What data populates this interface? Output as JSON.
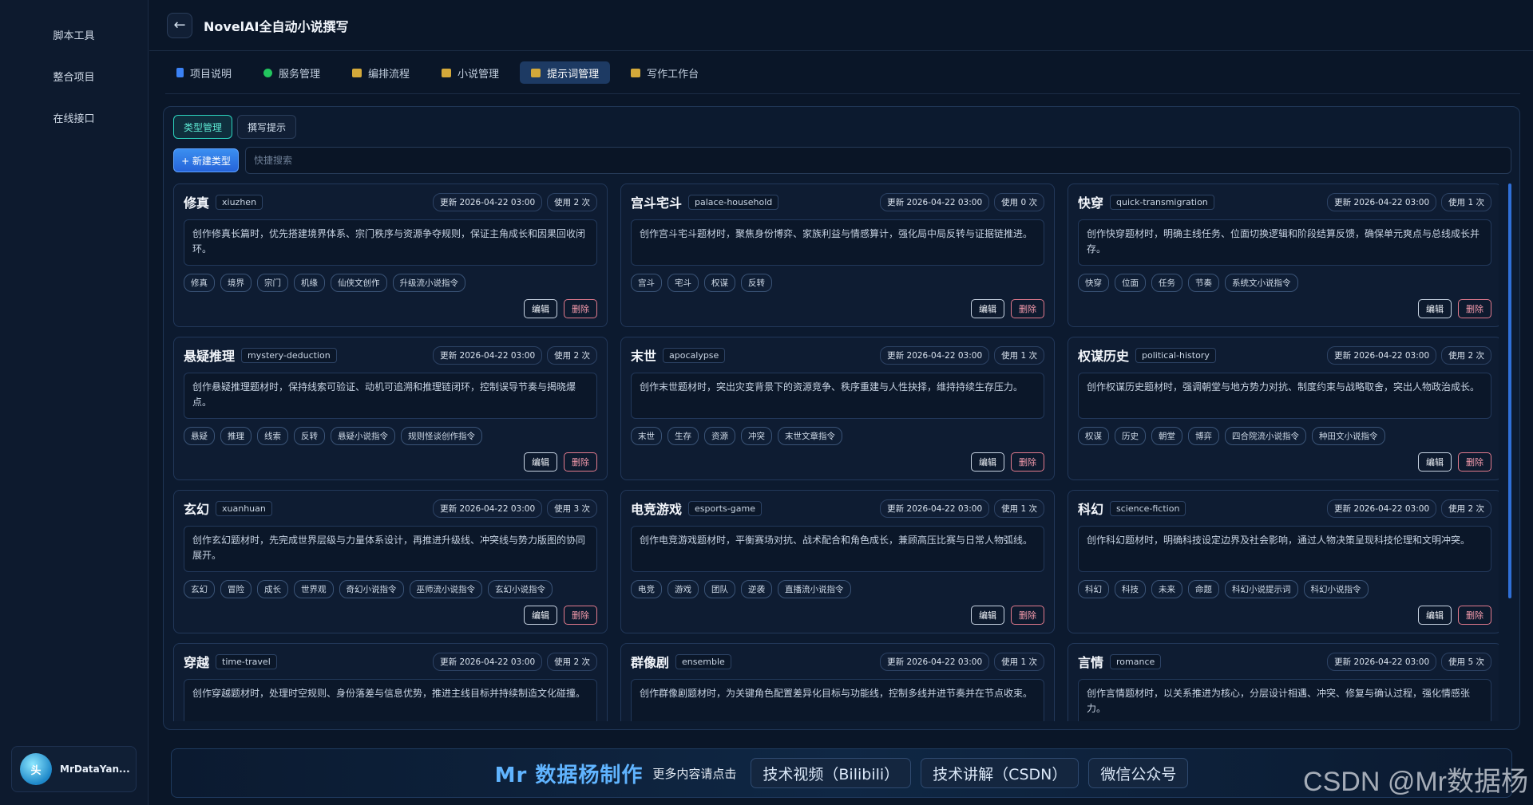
{
  "sidebar": {
    "items": [
      {
        "label": "脚本工具"
      },
      {
        "label": "整合项目"
      },
      {
        "label": "在线接口"
      }
    ],
    "user": {
      "avatar_text": "头",
      "name": "MrDataYan..."
    }
  },
  "header": {
    "back_icon": "←",
    "title": "NovelAI全自动小说撰写"
  },
  "tabs": [
    {
      "label": "项目说明",
      "icon": "doc-icon",
      "active": false
    },
    {
      "label": "服务管理",
      "icon": "status-dot-icon",
      "active": false
    },
    {
      "label": "编排流程",
      "icon": "folder-icon",
      "active": false
    },
    {
      "label": "小说管理",
      "icon": "folder-icon",
      "active": false
    },
    {
      "label": "提示词管理",
      "icon": "folder-icon",
      "active": true
    },
    {
      "label": "写作工作台",
      "icon": "folder-icon",
      "active": false
    }
  ],
  "subtabs": [
    {
      "label": "类型管理",
      "active": true
    },
    {
      "label": "撰写提示",
      "active": false
    }
  ],
  "new_button": "+ 新建类型",
  "search": {
    "placeholder": "快捷搜索",
    "value": ""
  },
  "card_labels": {
    "edit": "编辑",
    "delete": "删除"
  },
  "cards": [
    {
      "name": "修真",
      "slug": "xiuzhen",
      "updated": "更新 2026-04-22 03:00",
      "used": "使用 2 次",
      "desc": "创作修真长篇时，优先搭建境界体系、宗门秩序与资源争夺规则，保证主角成长和因果回收闭环。",
      "tags": [
        "修真",
        "境界",
        "宗门",
        "机缘",
        "仙侠文创作",
        "升级流小说指令"
      ]
    },
    {
      "name": "宫斗宅斗",
      "slug": "palace-household",
      "updated": "更新 2026-04-22 03:00",
      "used": "使用 0 次",
      "desc": "创作宫斗宅斗题材时，聚焦身份博弈、家族利益与情感算计，强化局中局反转与证据链推进。",
      "tags": [
        "宫斗",
        "宅斗",
        "权谋",
        "反转"
      ]
    },
    {
      "name": "快穿",
      "slug": "quick-transmigration",
      "updated": "更新 2026-04-22 03:00",
      "used": "使用 1 次",
      "desc": "创作快穿题材时，明确主线任务、位面切换逻辑和阶段结算反馈，确保单元爽点与总线成长并存。",
      "tags": [
        "快穿",
        "位面",
        "任务",
        "节奏",
        "系统文小说指令"
      ]
    },
    {
      "name": "悬疑推理",
      "slug": "mystery-deduction",
      "updated": "更新 2026-04-22 03:00",
      "used": "使用 2 次",
      "desc": "创作悬疑推理题材时，保持线索可验证、动机可追溯和推理链闭环，控制误导节奏与揭晓爆点。",
      "tags": [
        "悬疑",
        "推理",
        "线索",
        "反转",
        "悬疑小说指令",
        "规则怪谈创作指令"
      ]
    },
    {
      "name": "末世",
      "slug": "apocalypse",
      "updated": "更新 2026-04-22 03:00",
      "used": "使用 1 次",
      "desc": "创作末世题材时，突出灾变背景下的资源竞争、秩序重建与人性抉择，维持持续生存压力。",
      "tags": [
        "末世",
        "生存",
        "资源",
        "冲突",
        "末世文章指令"
      ]
    },
    {
      "name": "权谋历史",
      "slug": "political-history",
      "updated": "更新 2026-04-22 03:00",
      "used": "使用 2 次",
      "desc": "创作权谋历史题材时，强调朝堂与地方势力对抗、制度约束与战略取舍，突出人物政治成长。",
      "tags": [
        "权谋",
        "历史",
        "朝堂",
        "博弈",
        "四合院流小说指令",
        "种田文小说指令"
      ]
    },
    {
      "name": "玄幻",
      "slug": "xuanhuan",
      "updated": "更新 2026-04-22 03:00",
      "used": "使用 3 次",
      "desc": "创作玄幻题材时，先完成世界层级与力量体系设计，再推进升级线、冲突线与势力版图的协同展开。",
      "tags": [
        "玄幻",
        "冒险",
        "成长",
        "世界观",
        "奇幻小说指令",
        "巫师流小说指令",
        "玄幻小说指令"
      ]
    },
    {
      "name": "电竞游戏",
      "slug": "esports-game",
      "updated": "更新 2026-04-22 03:00",
      "used": "使用 1 次",
      "desc": "创作电竞游戏题材时，平衡赛场对抗、战术配合和角色成长，兼顾高压比赛与日常人物弧线。",
      "tags": [
        "电竞",
        "游戏",
        "团队",
        "逆袭",
        "直播流小说指令"
      ]
    },
    {
      "name": "科幻",
      "slug": "science-fiction",
      "updated": "更新 2026-04-22 03:00",
      "used": "使用 2 次",
      "desc": "创作科幻题材时，明确科技设定边界及社会影响，通过人物决策呈现科技伦理和文明冲突。",
      "tags": [
        "科幻",
        "科技",
        "未来",
        "命题",
        "科幻小说提示词",
        "科幻小说指令"
      ]
    },
    {
      "name": "穿越",
      "slug": "time-travel",
      "updated": "更新 2026-04-22 03:00",
      "used": "使用 2 次",
      "desc": "创作穿越题材时，处理时空规则、身份落差与信息优势，推进主线目标并持续制造文化碰撞。",
      "tags": []
    },
    {
      "name": "群像剧",
      "slug": "ensemble",
      "updated": "更新 2026-04-22 03:00",
      "used": "使用 1 次",
      "desc": "创作群像剧题材时，为关键角色配置差异化目标与功能线，控制多线并进节奏并在节点收束。",
      "tags": []
    },
    {
      "name": "言情",
      "slug": "romance",
      "updated": "更新 2026-04-22 03:00",
      "used": "使用 5 次",
      "desc": "创作言情题材时，以关系推进为核心，分层设计相遇、冲突、修复与确认过程，强化情感张力。",
      "tags": []
    }
  ],
  "footer": {
    "brand": "Mr 数据杨制作",
    "more": "更多内容请点击",
    "links": [
      "技术视频（Bilibili）",
      "技术讲解（CSDN）",
      "微信公众号"
    ]
  },
  "watermark": "CSDN @Mr数据杨",
  "colors": {
    "accent": "#2563d9",
    "active_tab": "#1d3a63",
    "danger": "#e37b8e",
    "teal": "#2dd4bf"
  }
}
